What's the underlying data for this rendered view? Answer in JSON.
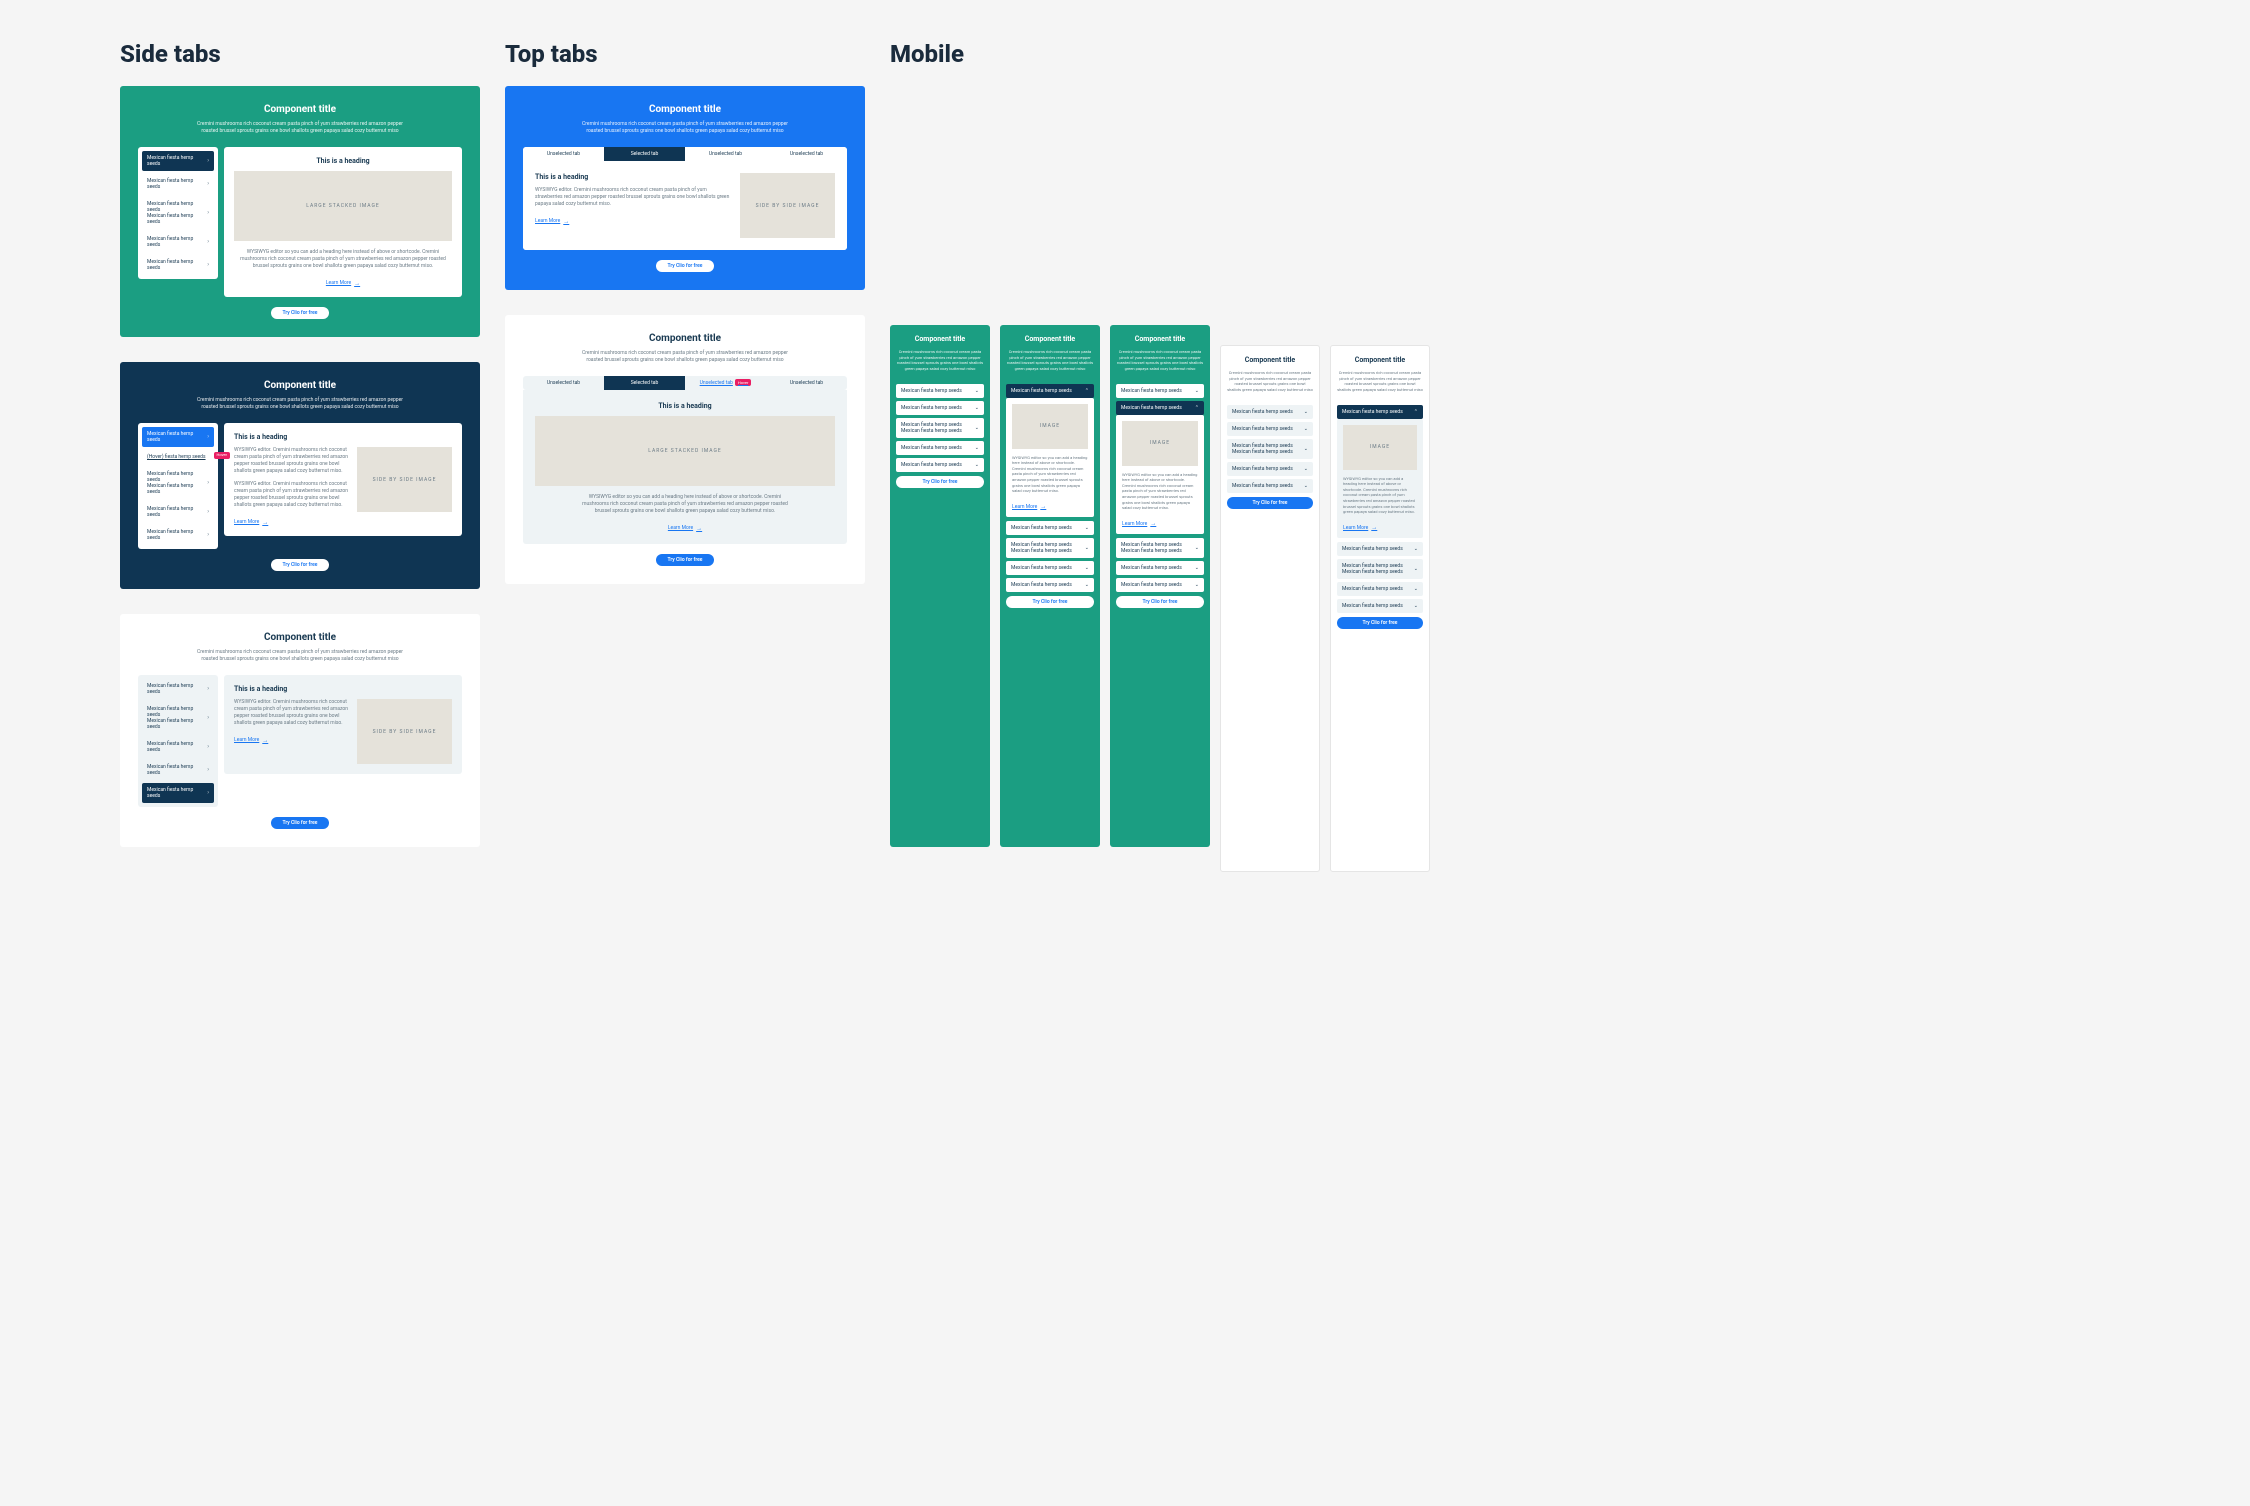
{
  "sections": {
    "side": "Side tabs",
    "top": "Top tabs",
    "mobile": "Mobile"
  },
  "shared": {
    "title": "Component title",
    "desc": "Cremini mushrooms rich coconut cream pasta pinch of yum strawberries red amazon pepper roasted brussel sprouts grains one bowl shallots green papaya salad cozy butternut miso",
    "heading": "This is a heading",
    "body_short": "WYSIWYG editor. Cremini mushrooms rich coconut cream pasta pinch of yum strawberries red amazon pepper roasted brussel sprouts grains one bowl shallots green papaya salad cozy butternut miso.",
    "body_long": "WYSIWYG editor so you can add a heading here instead of above or shortcode. Cremini mushrooms rich coconut cream pasta pinch of yum strawberries red amazon pepper roasted brussel sprouts grains one bowl shallots green papaya salad cozy butternut miso.",
    "body_med": "WYSIWYG editor. Cremini mushrooms rich coconut cream pasta pinch of yum strawberries red amazon pepper roasted brussel sprouts grains one bowl shallots green papaya salad cozy butternut miso.",
    "tab_label": "Mexican fiesta hemp seeds",
    "tab_label_2line": "Mexican fiesta hemp seeds\nMexican fiesta hemp seeds",
    "tab_hover": "(Hover) fiesta hemp seeds",
    "hover_badge": "Hover",
    "cta": "Try Clio for free",
    "learn_more": "Learn More",
    "img_large": "LARGE STACKED IMAGE",
    "img_side": "SIDE BY SIDE IMAGE",
    "img_mobile": "IMAGE",
    "top_unselected": "Unselected tab",
    "top_selected": "Selected tab"
  }
}
